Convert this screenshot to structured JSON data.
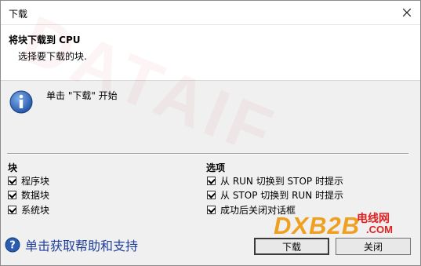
{
  "window": {
    "title": "下载"
  },
  "header": {
    "title": "将块下载到 CPU",
    "subtitle": "选择要下载的块."
  },
  "info": {
    "message": "单击 \"下载\" 开始"
  },
  "blocks": {
    "heading": "块",
    "items": [
      {
        "label": "程序块",
        "checked": true
      },
      {
        "label": "数据块",
        "checked": true
      },
      {
        "label": "系统块",
        "checked": true
      }
    ]
  },
  "options": {
    "heading": "选项",
    "items": [
      {
        "label": "从 RUN 切换到 STOP 时提示",
        "checked": true
      },
      {
        "label": "从 STOP 切换到 RUN 时提示",
        "checked": true
      },
      {
        "label": "成功后关闭对话框",
        "checked": true
      }
    ]
  },
  "help": {
    "label": "单击获取帮助和支持"
  },
  "buttons": {
    "download": "下载",
    "close": "关闭"
  },
  "watermark": {
    "text": "DATAIF"
  },
  "logo": {
    "main": "DXB2B",
    "cn": "电线网",
    "domain": ".COM"
  },
  "colors": {
    "accent": "#1f3f9a",
    "info_icon": "#2a5db0",
    "logo_orange": "#f0a020",
    "logo_red": "#e02020"
  }
}
